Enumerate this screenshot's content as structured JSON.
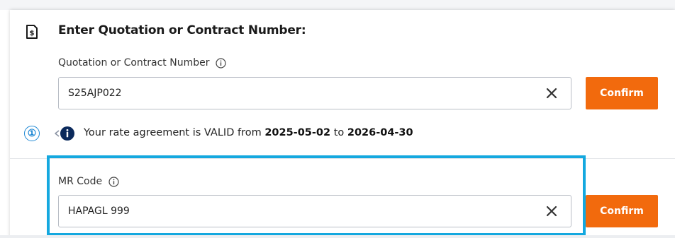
{
  "section": {
    "title": "Enter Quotation or Contract Number:",
    "icon": "document-dollar-icon"
  },
  "quotation": {
    "label": "Quotation or Contract Number",
    "value": "S25AJP022",
    "clear_icon": "close-icon",
    "info_icon": "info-icon",
    "confirm_label": "Confirm"
  },
  "validity": {
    "step_marker": "①",
    "text_before": "Your rate agreement is VALID from",
    "from_date": "2025-05-02",
    "connector": "to",
    "to_date": "2026-04-30",
    "icon": "info-badge-icon"
  },
  "mr_code": {
    "label": "MR Code",
    "value": "HAPAGL 999",
    "clear_icon": "close-icon",
    "info_icon": "info-icon",
    "confirm_label": "Confirm"
  },
  "colors": {
    "accent": "#f26a0d",
    "highlight": "#14a8df",
    "step_marker": "#1e88d4",
    "info_badge": "#0b2a5c"
  }
}
